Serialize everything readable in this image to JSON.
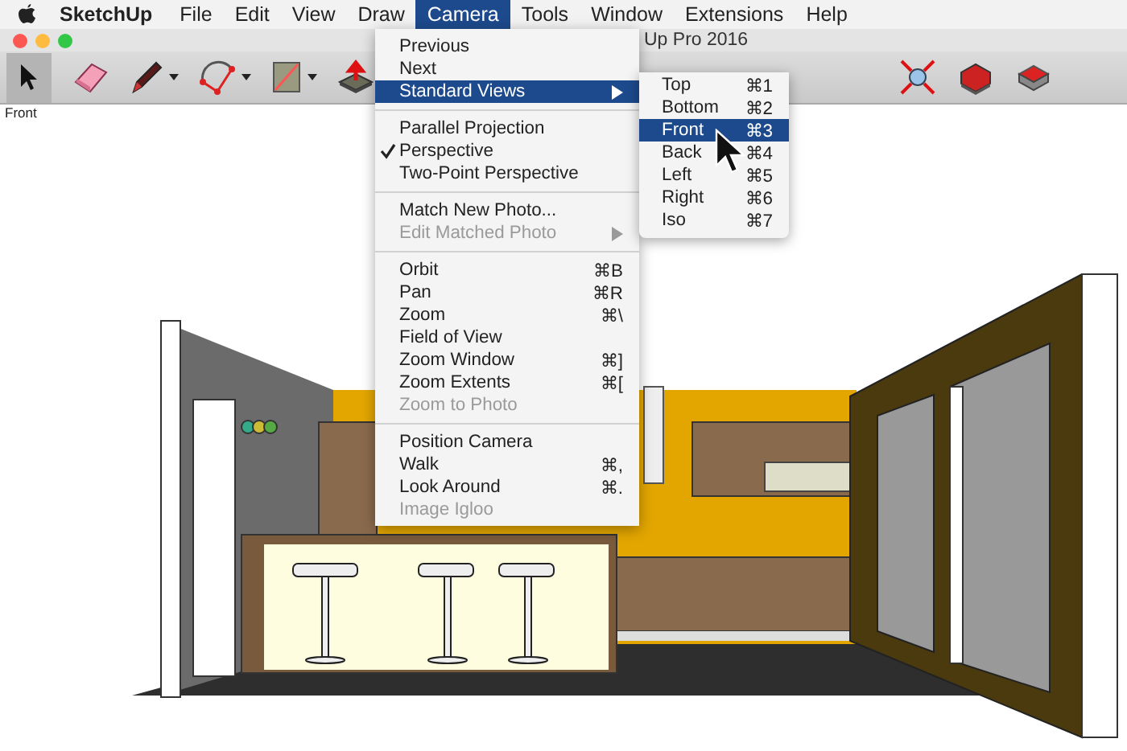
{
  "menu_bar": {
    "app_name": "SketchUp",
    "items": [
      {
        "label": "File",
        "selected": false
      },
      {
        "label": "Edit",
        "selected": false
      },
      {
        "label": "View",
        "selected": false
      },
      {
        "label": "Draw",
        "selected": false
      },
      {
        "label": "Camera",
        "selected": true
      },
      {
        "label": "Tools",
        "selected": false
      },
      {
        "label": "Window",
        "selected": false
      },
      {
        "label": "Extensions",
        "selected": false
      },
      {
        "label": "Help",
        "selected": false
      }
    ]
  },
  "window": {
    "title": "Up Pro 2016"
  },
  "toolbar": {
    "select_tool_selected": true
  },
  "scene_label": "Front",
  "camera_menu": {
    "sections": [
      [
        {
          "label": "Previous",
          "selected": false,
          "disabled": false,
          "checked": false,
          "has_submenu": false
        },
        {
          "label": "Next",
          "selected": false,
          "disabled": false,
          "checked": false,
          "has_submenu": false
        },
        {
          "label": "Standard Views",
          "selected": true,
          "disabled": false,
          "checked": false,
          "has_submenu": true
        }
      ],
      [
        {
          "label": "Parallel Projection",
          "selected": false,
          "disabled": false,
          "checked": false,
          "has_submenu": false
        },
        {
          "label": "Perspective",
          "selected": false,
          "disabled": false,
          "checked": true,
          "has_submenu": false
        },
        {
          "label": "Two-Point Perspective",
          "selected": false,
          "disabled": false,
          "checked": false,
          "has_submenu": false
        }
      ],
      [
        {
          "label": "Match New Photo...",
          "selected": false,
          "disabled": false,
          "checked": false,
          "has_submenu": false
        },
        {
          "label": "Edit Matched Photo",
          "selected": false,
          "disabled": true,
          "checked": false,
          "has_submenu": true
        }
      ],
      [
        {
          "label": "Orbit",
          "shortcut": "⌘B",
          "selected": false,
          "disabled": false,
          "checked": false,
          "has_submenu": false
        },
        {
          "label": "Pan",
          "shortcut": "⌘R",
          "selected": false,
          "disabled": false,
          "checked": false,
          "has_submenu": false
        },
        {
          "label": "Zoom",
          "shortcut": "⌘\\",
          "selected": false,
          "disabled": false,
          "checked": false,
          "has_submenu": false
        },
        {
          "label": "Field of View",
          "selected": false,
          "disabled": false,
          "checked": false,
          "has_submenu": false
        },
        {
          "label": "Zoom Window",
          "shortcut": "⌘]",
          "selected": false,
          "disabled": false,
          "checked": false,
          "has_submenu": false
        },
        {
          "label": "Zoom Extents",
          "shortcut": "⌘[",
          "selected": false,
          "disabled": false,
          "checked": false,
          "has_submenu": false
        },
        {
          "label": "Zoom to Photo",
          "selected": false,
          "disabled": true,
          "checked": false,
          "has_submenu": false
        }
      ],
      [
        {
          "label": "Position Camera",
          "selected": false,
          "disabled": false,
          "checked": false,
          "has_submenu": false
        },
        {
          "label": "Walk",
          "shortcut": "⌘,",
          "selected": false,
          "disabled": false,
          "checked": false,
          "has_submenu": false
        },
        {
          "label": "Look Around",
          "shortcut": "⌘.",
          "selected": false,
          "disabled": false,
          "checked": false,
          "has_submenu": false
        },
        {
          "label": "Image Igloo",
          "selected": false,
          "disabled": true,
          "checked": false,
          "has_submenu": false
        }
      ]
    ]
  },
  "standard_views_menu": {
    "items": [
      {
        "label": "Top",
        "shortcut": "⌘1",
        "selected": false
      },
      {
        "label": "Bottom",
        "shortcut": "⌘2",
        "selected": false
      },
      {
        "label": "Front",
        "shortcut": "⌘3",
        "selected": true
      },
      {
        "label": "Back",
        "shortcut": "⌘4",
        "selected": false
      },
      {
        "label": "Left",
        "shortcut": "⌘5",
        "selected": false
      },
      {
        "label": "Right",
        "shortcut": "⌘6",
        "selected": false
      },
      {
        "label": "Iso",
        "shortcut": "⌘7",
        "selected": false
      }
    ]
  }
}
